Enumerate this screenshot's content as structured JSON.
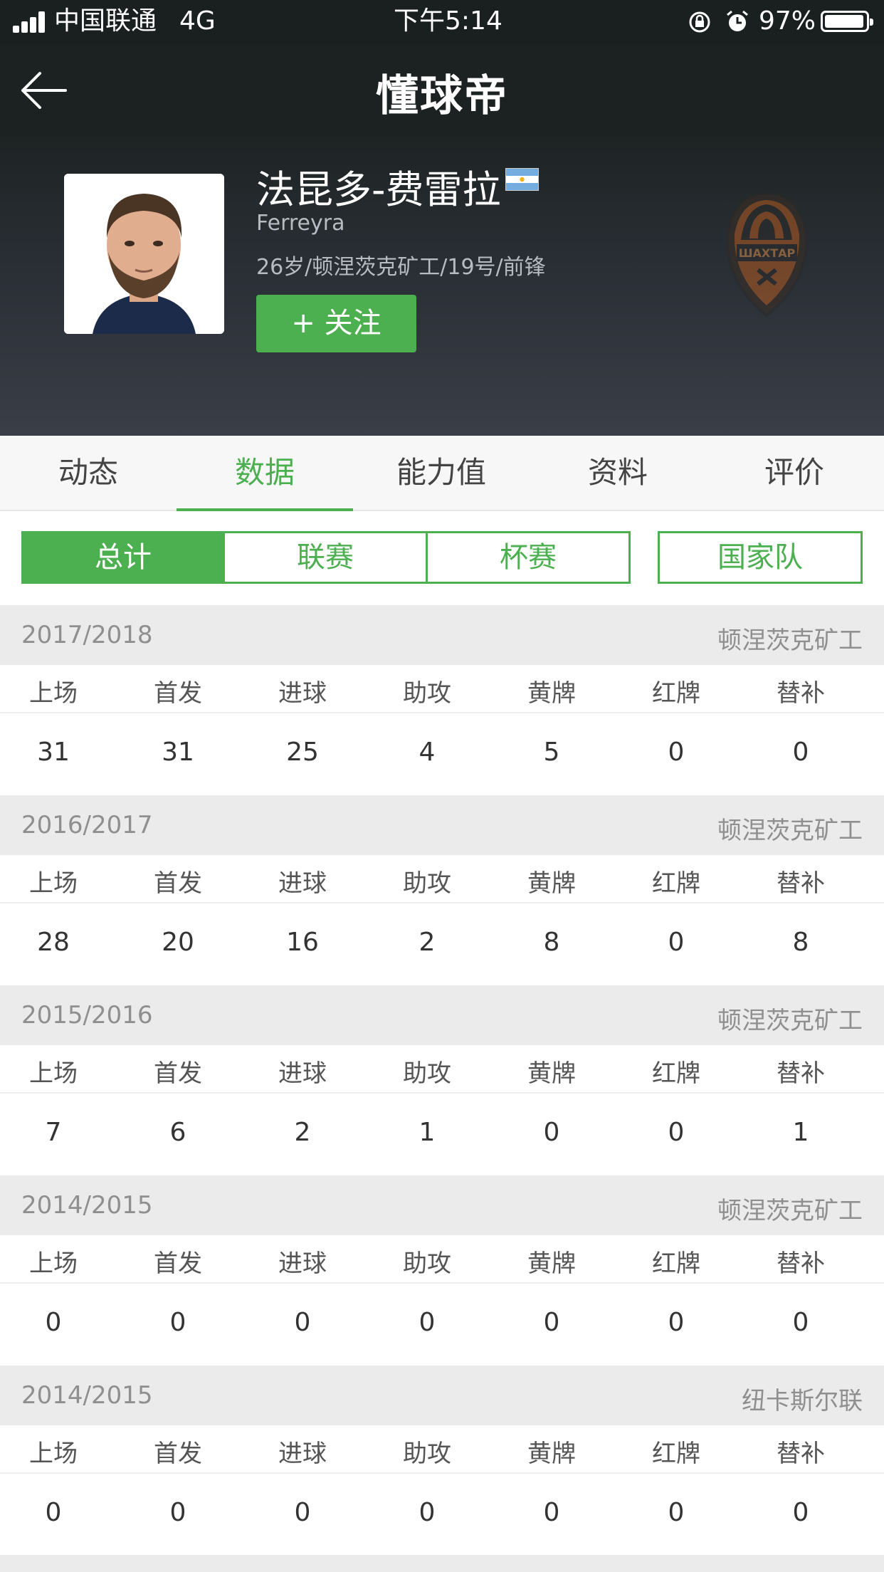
{
  "status_bar": {
    "carrier": "中国联通",
    "network": "4G",
    "time": "下午5:14",
    "battery": "97%"
  },
  "header": {
    "title": "懂球帝",
    "icons": [
      "back-arrow-icon"
    ]
  },
  "player": {
    "name": "法昆多-费雷拉",
    "english_name": "Ferreyra",
    "info": "26岁/顿涅茨克矿工/19号/前锋",
    "follow_label": "+ 关注",
    "club_logo_text": "ШАХТАР",
    "flag": "argentina-flag-icon"
  },
  "tabs": [
    {
      "label": "动态"
    },
    {
      "label": "数据"
    },
    {
      "label": "能力值"
    },
    {
      "label": "资料"
    },
    {
      "label": "评价"
    }
  ],
  "active_tab": "数据",
  "filters": [
    {
      "label": "总计"
    },
    {
      "label": "联赛"
    },
    {
      "label": "杯赛"
    },
    {
      "label": "国家队"
    }
  ],
  "active_filter": "总计",
  "stat_headers": [
    "上场",
    "首发",
    "进球",
    "助攻",
    "黄牌",
    "红牌",
    "替补"
  ],
  "seasons": [
    {
      "year": "2017/2018",
      "club": "顿涅茨克矿工",
      "values": [
        "31",
        "31",
        "25",
        "4",
        "5",
        "0",
        "0"
      ]
    },
    {
      "year": "2016/2017",
      "club": "顿涅茨克矿工",
      "values": [
        "28",
        "20",
        "16",
        "2",
        "8",
        "0",
        "8"
      ]
    },
    {
      "year": "2015/2016",
      "club": "顿涅茨克矿工",
      "values": [
        "7",
        "6",
        "2",
        "1",
        "0",
        "0",
        "1"
      ]
    },
    {
      "year": "2014/2015",
      "club": "顿涅茨克矿工",
      "values": [
        "0",
        "0",
        "0",
        "0",
        "0",
        "0",
        "0"
      ]
    },
    {
      "year": "2014/2015",
      "club": "纽卡斯尔联",
      "values": [
        "0",
        "0",
        "0",
        "0",
        "0",
        "0",
        "0"
      ]
    }
  ],
  "colors": {
    "accent": "#4caf50",
    "header_bg": "#1c2222",
    "section_bg": "#ebebeb"
  }
}
